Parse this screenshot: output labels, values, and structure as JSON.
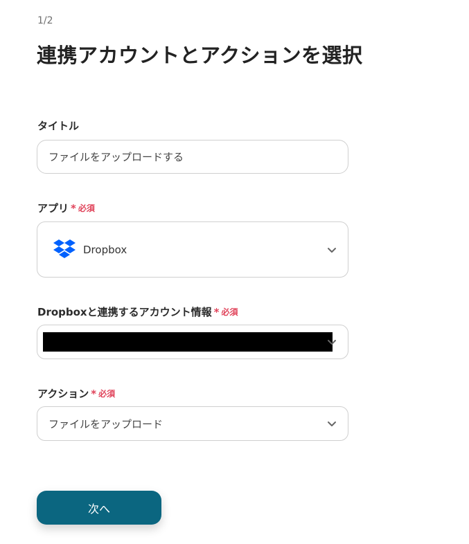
{
  "header": {
    "step": "1/2",
    "title": "連携アカウントとアクションを選択"
  },
  "form": {
    "required_mark": "*",
    "required_text": "必須",
    "title_field": {
      "label": "タイトル",
      "value": "ファイルをアップロードする"
    },
    "app_field": {
      "label": "アプリ",
      "selected": "Dropbox",
      "icon": "dropbox-logo-icon",
      "icon_color": "#0061fe"
    },
    "account_field": {
      "label": "Dropboxと連携するアカウント情報"
    },
    "action_field": {
      "label": "アクション",
      "selected": "ファイルをアップロード"
    }
  },
  "footer": {
    "next_label": "次へ",
    "next_color": "#0b6680"
  }
}
